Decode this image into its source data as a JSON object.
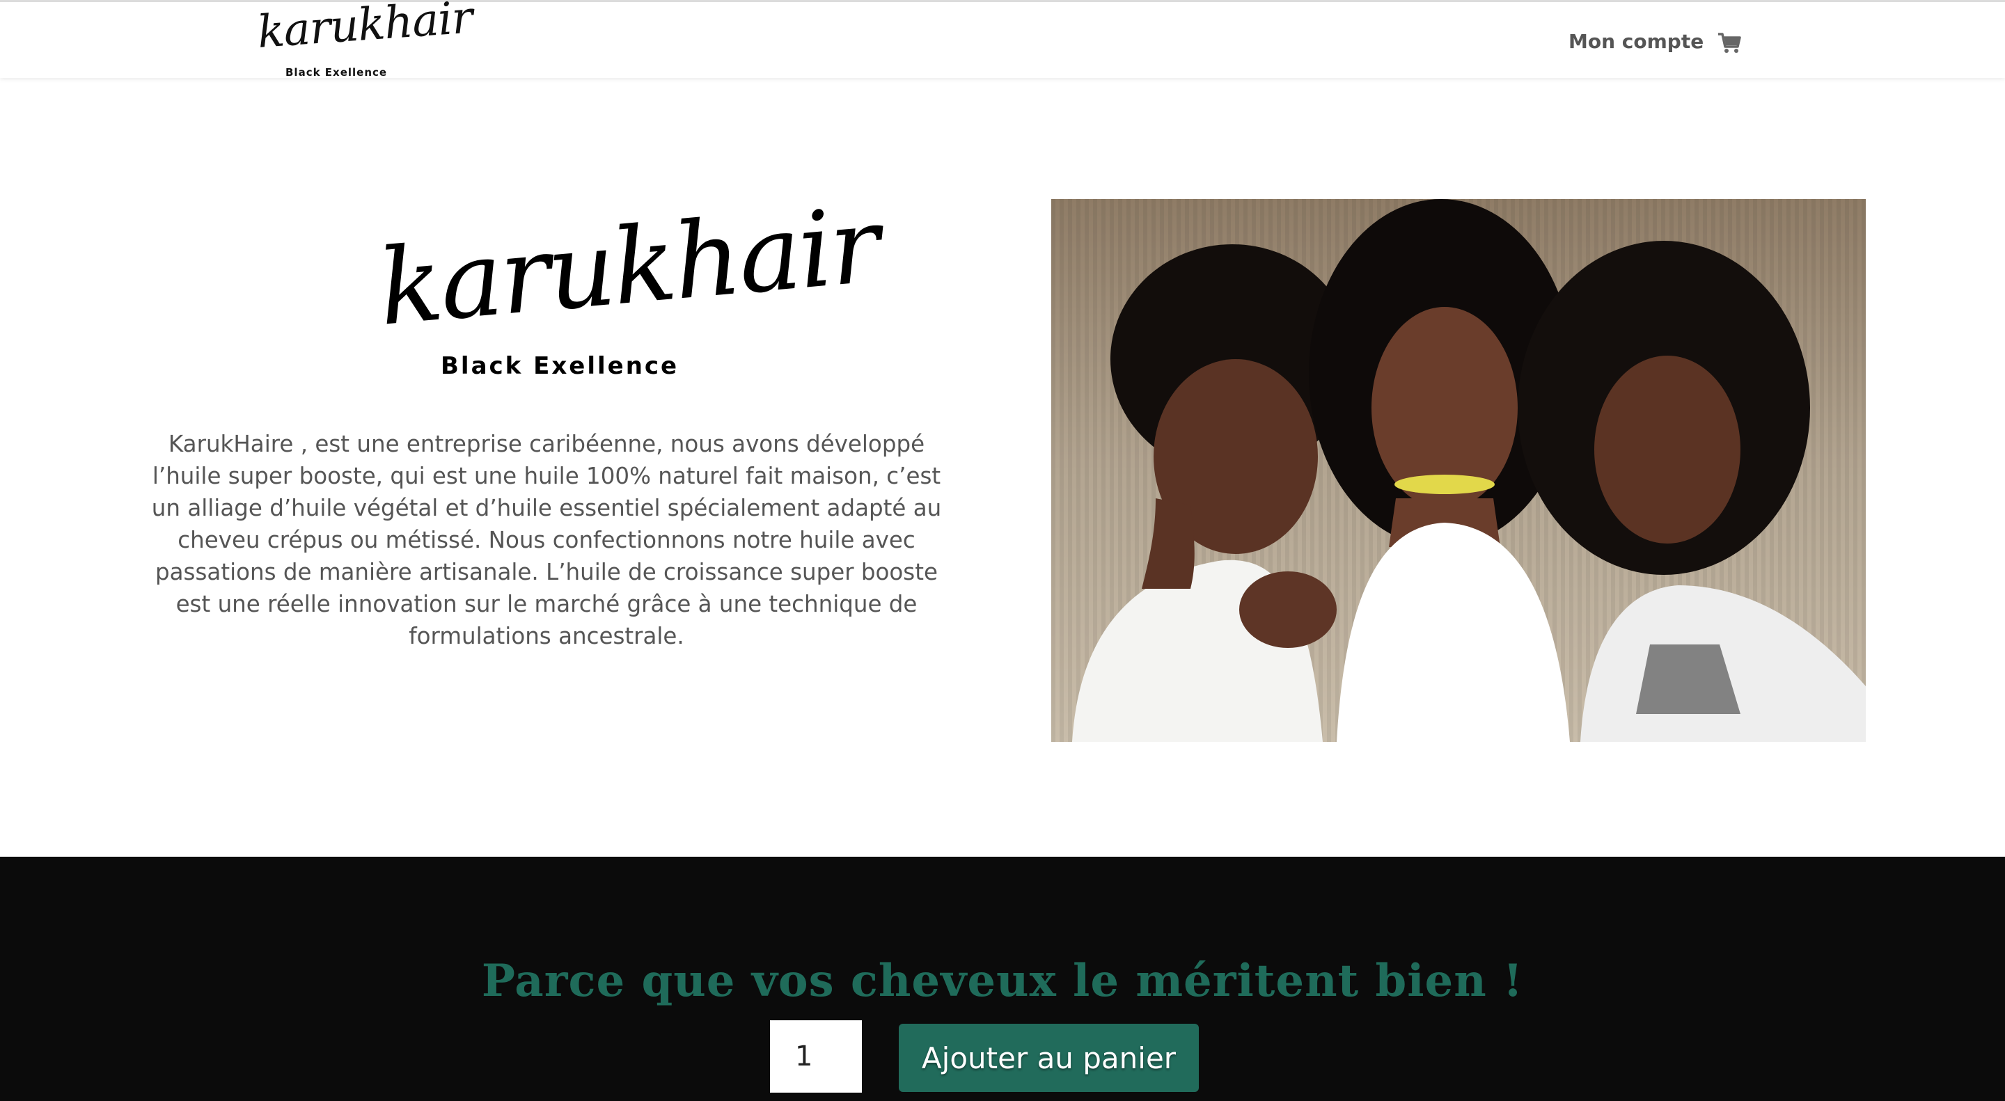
{
  "header": {
    "logo": {
      "script": "karukhair",
      "tagline": "Black Exellence"
    },
    "nav": {
      "account_label": "Mon compte",
      "cart_icon": "shopping-cart-icon"
    }
  },
  "intro": {
    "logo": {
      "script": "karukhair",
      "tagline": "Black Exellence"
    },
    "description": "KarukHaire , est une entreprise caribéenne, nous avons développé l’huile super booste, qui est une huile 100% naturel fait maison, c’est un alliage d’huile végétal et d’huile essentiel spécialement adapté au cheveu crépus ou métissé. Nous confectionnons notre huile avec passations de manière artisanale. L’huile de croissance super booste est une réelle innovation sur le marché grâce à une technique de formulations ancestrale.",
    "photo": "three-women-smiling-photo"
  },
  "cta": {
    "title": "Parce que vos cheveux le méritent bien !",
    "quantity_value": "1",
    "add_to_cart_label": "Ajouter au panier",
    "title_color": "#1f6b5a",
    "button_color": "#216b5b"
  },
  "colors": {
    "background": "#ffffff",
    "dark_section": "#0b0b0b",
    "body_text": "#555555"
  }
}
